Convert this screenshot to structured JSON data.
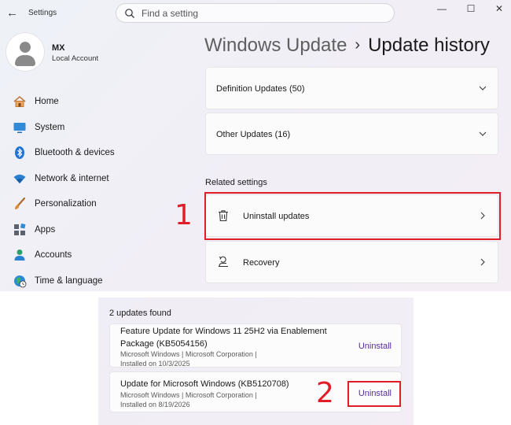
{
  "titlebar": {
    "app_title": "Settings",
    "search_placeholder": "Find a setting",
    "minimize": "—",
    "maximize": "☐",
    "close": "✕",
    "back": "←"
  },
  "profile": {
    "name": "MX",
    "account_type": "Local Account"
  },
  "sidebar": {
    "items": [
      {
        "label": "Home",
        "icon": "home-icon"
      },
      {
        "label": "System",
        "icon": "system-icon"
      },
      {
        "label": "Bluetooth & devices",
        "icon": "bluetooth-icon"
      },
      {
        "label": "Network & internet",
        "icon": "wifi-icon"
      },
      {
        "label": "Personalization",
        "icon": "brush-icon"
      },
      {
        "label": "Apps",
        "icon": "apps-icon"
      },
      {
        "label": "Accounts",
        "icon": "accounts-icon"
      },
      {
        "label": "Time & language",
        "icon": "globe-clock-icon"
      }
    ]
  },
  "header": {
    "breadcrumb_parent": "Windows Update",
    "separator": "›",
    "current": "Update history"
  },
  "update_groups": [
    {
      "label": "Definition Updates (50)"
    },
    {
      "label": "Other Updates (16)"
    }
  ],
  "related": {
    "heading": "Related settings",
    "items": [
      {
        "label": "Uninstall updates",
        "icon": "trash-icon"
      },
      {
        "label": "Recovery",
        "icon": "recovery-icon"
      }
    ]
  },
  "uninstall_panel": {
    "count_text": "2 updates found",
    "updates": [
      {
        "name_line1": "Feature Update for Windows 11 25H2 via Enablement",
        "name_line2": "Package (KB5054156)",
        "meta": "Microsoft Windows  |  Microsoft Corporation  |",
        "installed": "Installed on 10/3/2025",
        "action": "Uninstall"
      },
      {
        "name_line1": "Update for Microsoft Windows (KB5120708)",
        "meta": "Microsoft Windows  |  Microsoft Corporation  |",
        "installed": "Installed on 8/19/2026",
        "action": "Uninstall"
      }
    ]
  },
  "annotations": {
    "step1": "1",
    "step2": "2",
    "highlight_color": "#e01e2a"
  }
}
